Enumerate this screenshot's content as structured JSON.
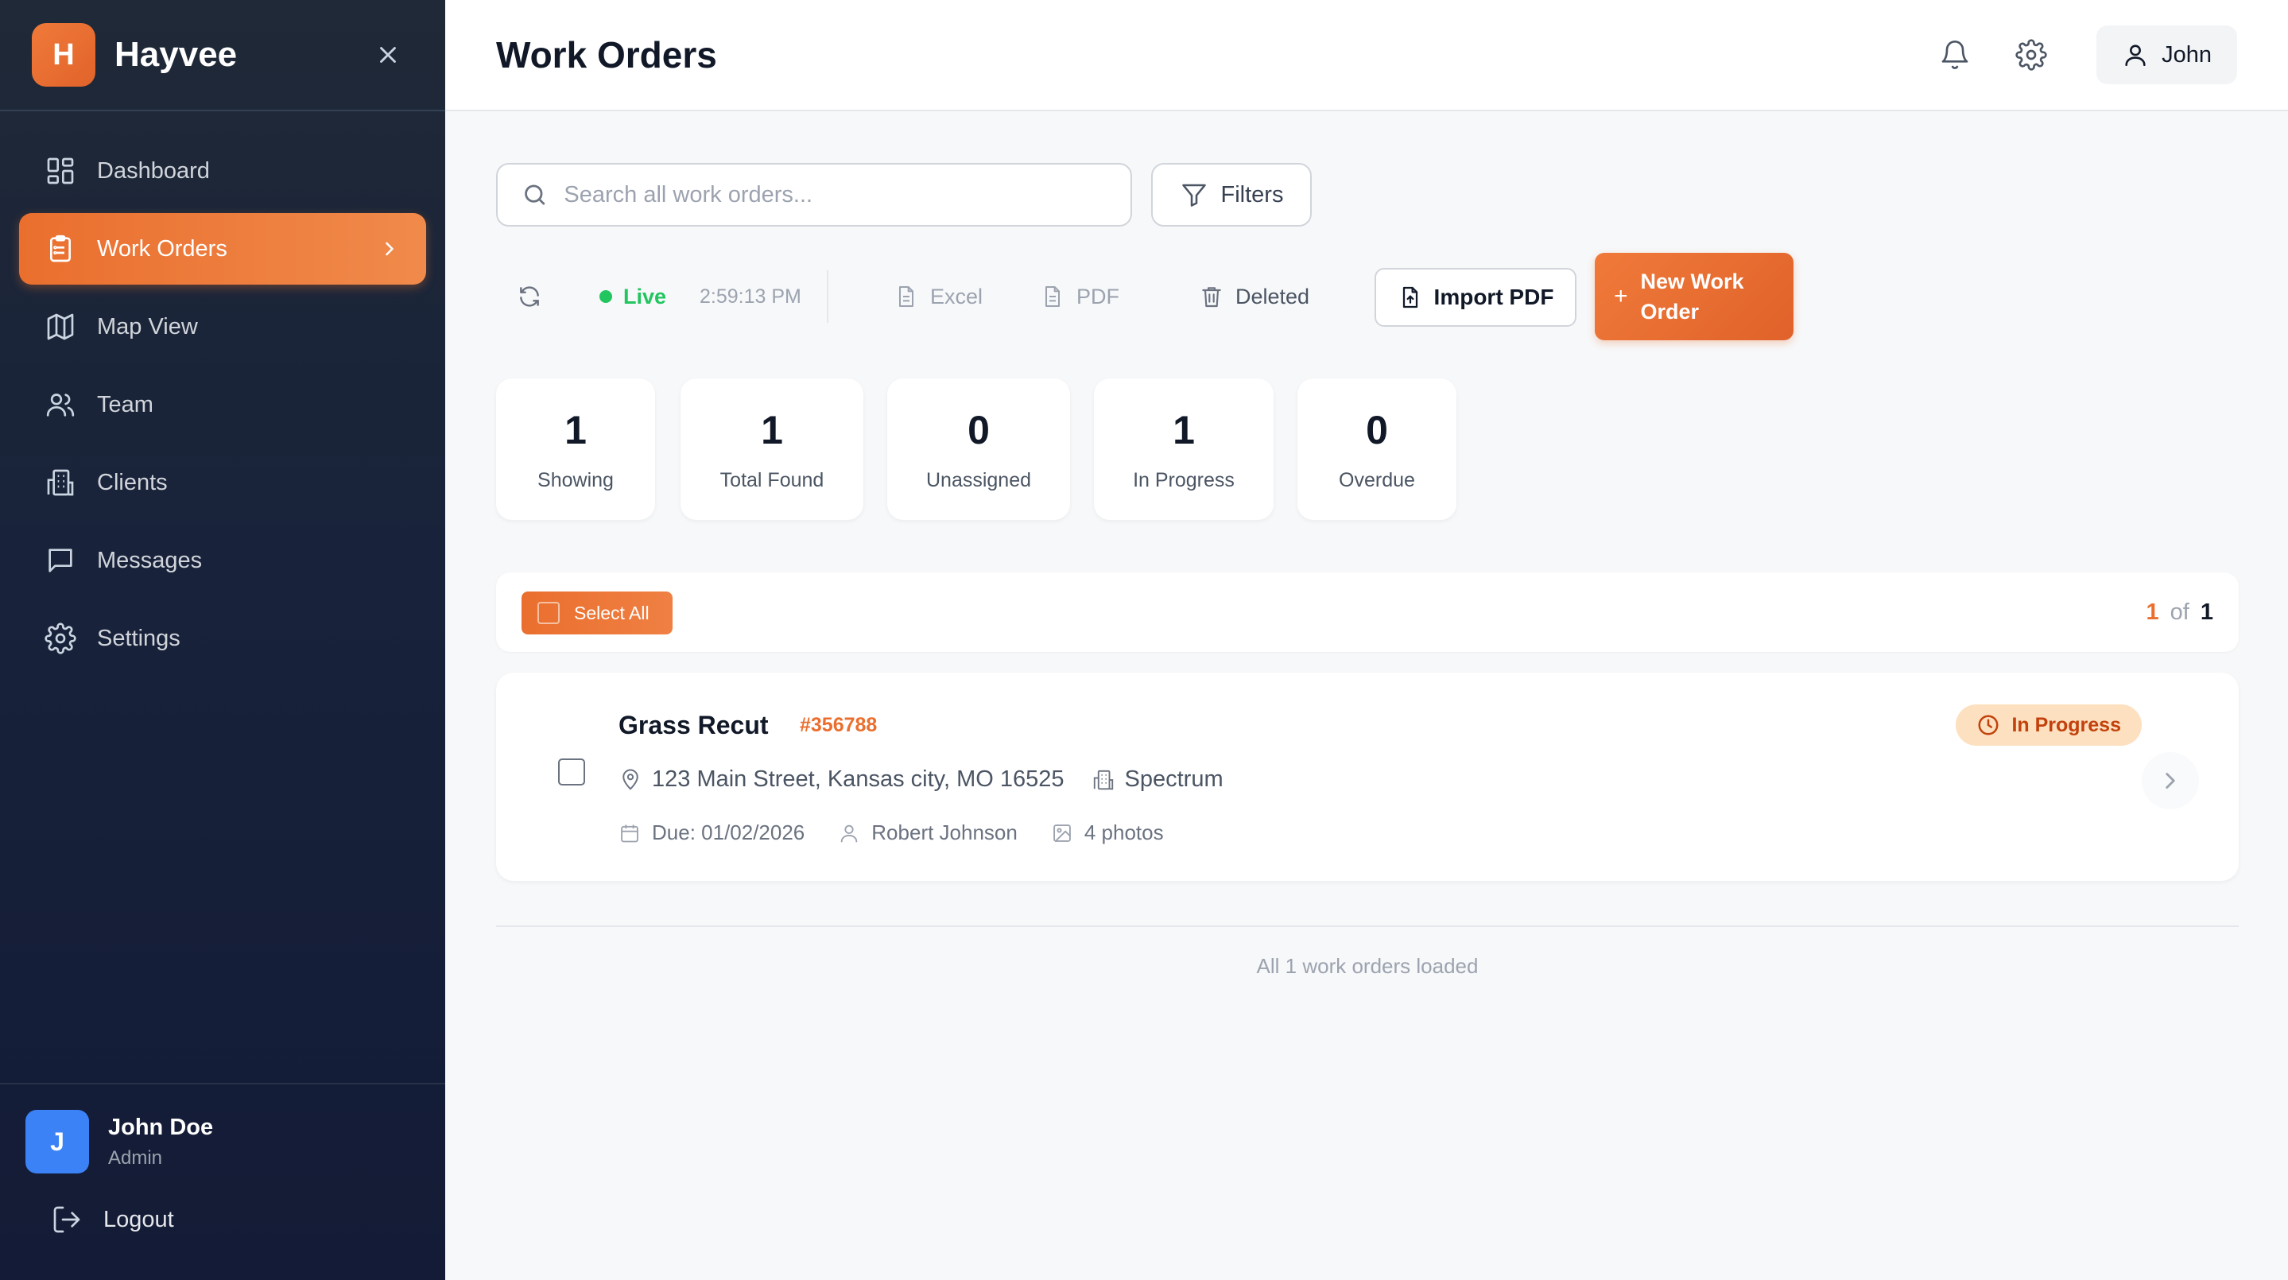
{
  "app": {
    "logo_letter": "H",
    "name": "Hayvee"
  },
  "sidebar": {
    "items": [
      {
        "label": "Dashboard",
        "icon": "dashboard-icon"
      },
      {
        "label": "Work Orders",
        "icon": "clipboard-icon",
        "active": true
      },
      {
        "label": "Map View",
        "icon": "map-icon"
      },
      {
        "label": "Team",
        "icon": "team-icon"
      },
      {
        "label": "Clients",
        "icon": "building-icon"
      },
      {
        "label": "Messages",
        "icon": "message-icon"
      },
      {
        "label": "Settings",
        "icon": "gear-icon"
      }
    ],
    "user": {
      "initial": "J",
      "name": "John Doe",
      "role": "Admin"
    },
    "logout_label": "Logout"
  },
  "header": {
    "title": "Work Orders",
    "user_label": "John"
  },
  "search": {
    "placeholder": "Search all work orders...",
    "value": ""
  },
  "filters_label": "Filters",
  "toolbar": {
    "live_label": "Live",
    "time": "2:59:13 PM",
    "excel_label": "Excel",
    "pdf_label": "PDF",
    "deleted_label": "Deleted",
    "import_label": "Import PDF",
    "new_label": "New Work Order"
  },
  "stats": [
    {
      "value": "1",
      "label": "Showing"
    },
    {
      "value": "1",
      "label": "Total Found"
    },
    {
      "value": "0",
      "label": "Unassigned"
    },
    {
      "value": "1",
      "label": "In Progress"
    },
    {
      "value": "0",
      "label": "Overdue"
    }
  ],
  "list": {
    "select_all_label": "Select All",
    "page_current": "1",
    "page_of": "of",
    "page_total": "1",
    "footer_text": "All 1 work orders loaded"
  },
  "work_orders": [
    {
      "title": "Grass Recut",
      "id": "#356788",
      "address": "123 Main Street, Kansas city, MO 16525",
      "client": "Spectrum",
      "due": "Due: 01/02/2026",
      "assignee": "Robert Johnson",
      "photos": "4 photos",
      "status": "In Progress"
    }
  ],
  "colors": {
    "accent": "#ea6f2e",
    "sidebar_bg": "#1f2937",
    "live": "#22c55e",
    "status_bg": "#fde0bf",
    "status_text": "#c2410c",
    "avatar": "#3b82f6"
  }
}
